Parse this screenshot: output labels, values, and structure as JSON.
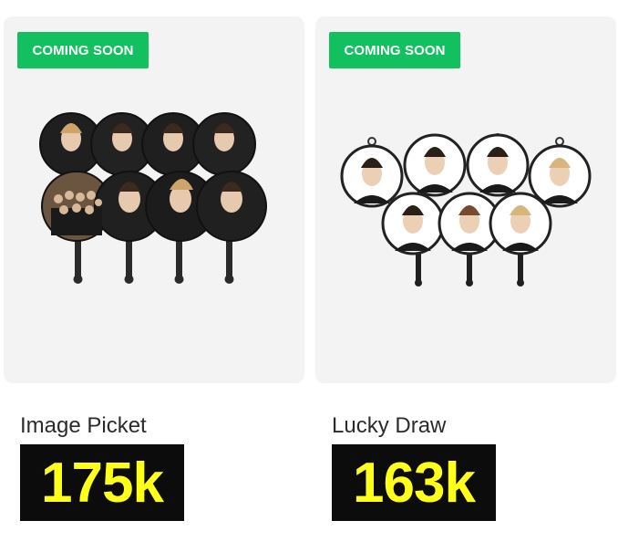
{
  "products": [
    {
      "badge": "COMING SOON",
      "title": "Image Picket",
      "count": "175k",
      "badge_color": "#12c05f",
      "count_text_color": "#ffff1a"
    },
    {
      "badge": "COMING SOON",
      "title": "Lucky Draw",
      "count": "163k",
      "badge_color": "#12c05f",
      "count_text_color": "#ffff1a"
    }
  ]
}
